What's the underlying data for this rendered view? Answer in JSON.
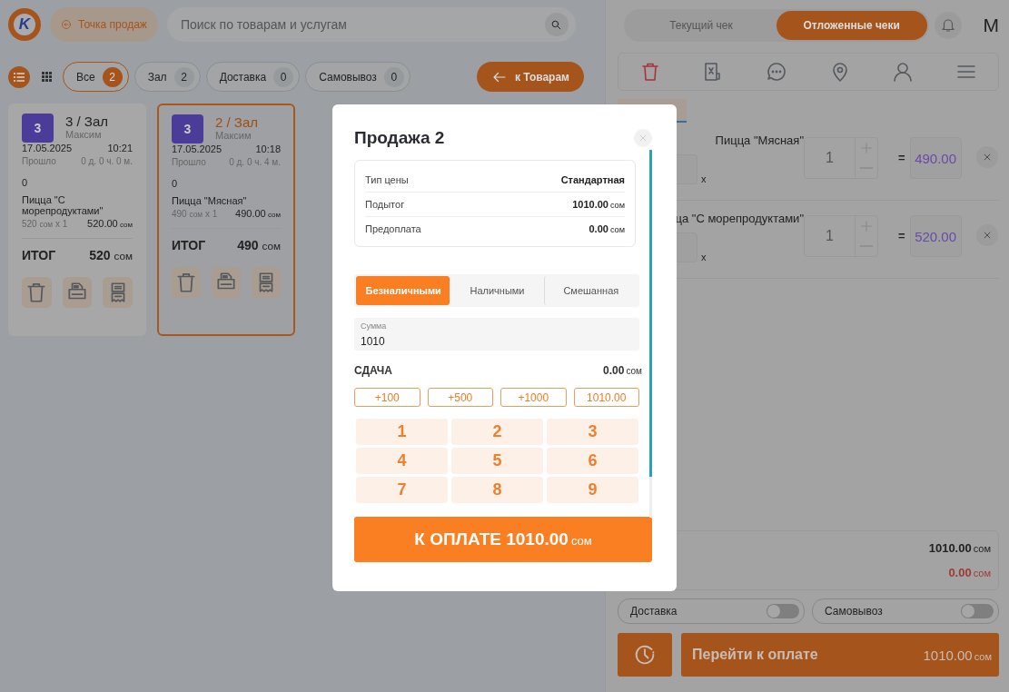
{
  "header": {
    "logo": "K",
    "point_button": "Точка продаж",
    "search": {
      "placeholder": "Поиск по товарам и услугам"
    }
  },
  "view_modes": [
    {
      "kind": "list",
      "selected": true
    },
    {
      "kind": "grid",
      "selected": false
    }
  ],
  "filters": [
    {
      "label": "Все",
      "count": "2",
      "selected": true
    },
    {
      "label": "Зал",
      "count": "2",
      "selected": false
    },
    {
      "label": "Доставка",
      "count": "0",
      "selected": false
    },
    {
      "label": "Самовывоз",
      "count": "0",
      "selected": false
    }
  ],
  "back_button": "к Товарам",
  "orders": [
    {
      "badge": "3",
      "title": "3 / Зал",
      "waiter": "Максим",
      "date": "17.05.2025",
      "time": "10:21",
      "elapsed_label": "Прошло",
      "elapsed": "0 д. 0 ч. 0 м.",
      "guests": "0",
      "items": [
        {
          "name": "Пицца \"С морепродуктами\"",
          "unit_price": "520",
          "unit": "сом",
          "qty": "x 1",
          "sum": "520.00",
          "sum_unit": "сом"
        }
      ],
      "total_label": "ИТОГ",
      "total": "520",
      "total_unit": "сом",
      "selected": false
    },
    {
      "badge": "3",
      "title": "2 / Зал",
      "waiter": "Максим",
      "date": "17.05.2025",
      "time": "10:18",
      "elapsed_label": "Прошло",
      "elapsed": "0 д. 0 ч. 4 м.",
      "guests": "0",
      "items": [
        {
          "name": "Пицца \"Мясная\"",
          "unit_price": "490",
          "unit": "сом",
          "qty": "x 1",
          "sum": "490.00",
          "sum_unit": "сом"
        }
      ],
      "total_label": "ИТОГ",
      "total": "490",
      "total_unit": "сом",
      "selected": true
    }
  ],
  "receipt_tabs": [
    {
      "label": "Текущий чек",
      "selected": false
    },
    {
      "label": "Отложенные чеки",
      "selected": true
    }
  ],
  "user_initial": "М",
  "cart": {
    "lines": [
      {
        "name": "Пицца \"Мясная\"",
        "times": "x",
        "qty": "1",
        "equals": "=",
        "sum": "490.00"
      },
      {
        "name": "ца \"С морепродуктами\"",
        "times": "x",
        "qty": "1",
        "equals": "=",
        "sum": "520.00"
      }
    ],
    "summary": [
      {
        "kind": "total",
        "value": "1010.00",
        "unit": "сом"
      },
      {
        "kind": "due",
        "value": "0.00",
        "unit": "сом"
      }
    ],
    "toggles": [
      {
        "label": "Доставка",
        "on": false
      },
      {
        "label": "Самовывоз",
        "on": false
      }
    ],
    "pay_button": {
      "label": "Перейти к оплате",
      "amount": "1010.00",
      "unit": "сом"
    }
  },
  "modal": {
    "title": "Продажа 2",
    "info": [
      {
        "label": "Тип цены",
        "value": "Стандартная"
      },
      {
        "label": "Подытог",
        "value": "1010.00",
        "unit": "сом"
      },
      {
        "label": "Предоплата",
        "value": "0.00",
        "unit": "сом"
      }
    ],
    "payment_tabs": [
      {
        "label": "Безналичными",
        "selected": true
      },
      {
        "label": "Наличными",
        "selected": false
      },
      {
        "label": "Смешанная",
        "selected": false
      }
    ],
    "amount_field": {
      "label": "Сумма",
      "value": "1010"
    },
    "change": {
      "label": "СДАЧА",
      "value": "0.00",
      "unit": "сом"
    },
    "quick_amounts": [
      "+100",
      "+500",
      "+1000",
      "1010.00"
    ],
    "keypad": [
      "1",
      "2",
      "3",
      "4",
      "5",
      "6",
      "7",
      "8",
      "9"
    ],
    "pay_button": {
      "label": "К ОПЛАТЕ",
      "amount": "1010.00",
      "unit": "сом"
    }
  }
}
